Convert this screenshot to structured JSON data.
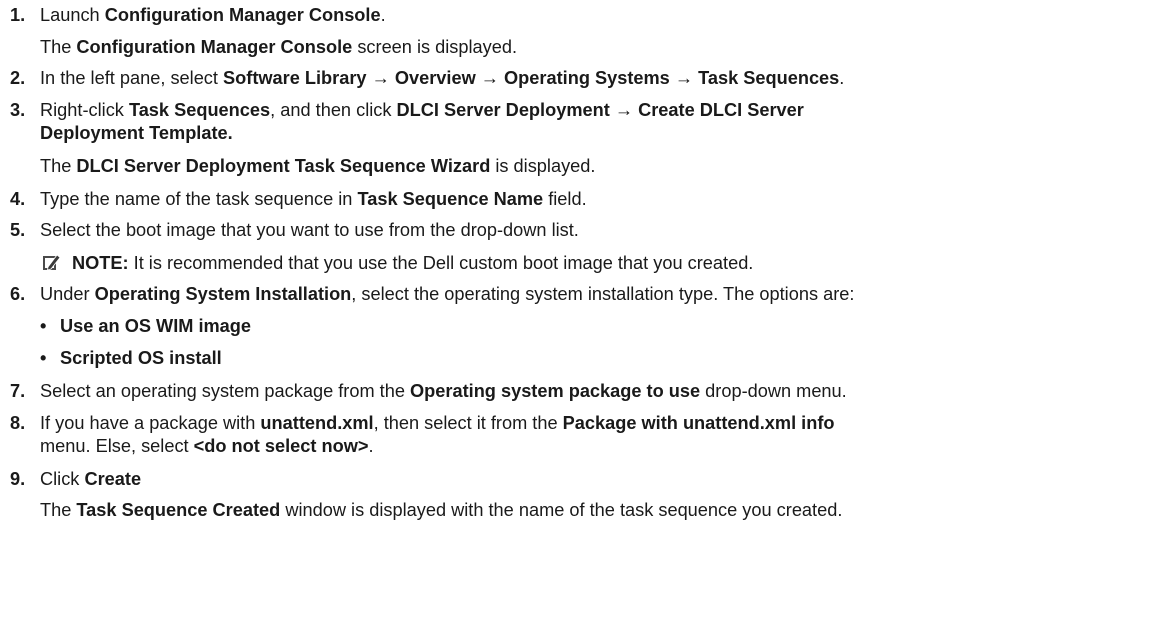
{
  "steps": [
    {
      "number": "1.",
      "parts": [
        [
          "Launch ",
          false
        ],
        [
          "Configuration Manager Console",
          true
        ],
        [
          ".",
          false
        ]
      ]
    },
    {
      "number": "",
      "parts": [
        [
          "The ",
          false
        ],
        [
          "Configuration Manager Console",
          true
        ],
        [
          " screen is displayed.",
          false
        ]
      ]
    },
    {
      "number": "2.",
      "parts": [
        [
          "In the left pane, select ",
          false
        ],
        [
          "Software Library",
          true
        ],
        [
          " → ",
          false
        ],
        [
          "Overview",
          true
        ],
        [
          " → ",
          false
        ],
        [
          "Operating Systems",
          true
        ],
        [
          " → ",
          false
        ],
        [
          "Task Sequences",
          true
        ],
        [
          ".",
          false
        ]
      ]
    },
    {
      "number": "3.",
      "parts": [
        [
          "Right-click ",
          false
        ],
        [
          "Task Sequences",
          true
        ],
        [
          ", and then click ",
          false
        ],
        [
          "DLCI Server Deployment",
          true
        ],
        [
          " → ",
          false
        ],
        [
          "Create DLCI Server",
          true
        ]
      ]
    },
    {
      "number": "",
      "parts": [
        [
          "Deployment Template.",
          true
        ]
      ]
    },
    {
      "number": "",
      "parts": [
        [
          "The ",
          false
        ],
        [
          "DLCI Server Deployment Task Sequence Wizard",
          true
        ],
        [
          " is displayed.",
          false
        ]
      ]
    },
    {
      "number": "4.",
      "parts": [
        [
          "Type the name of the task sequence in ",
          false
        ],
        [
          "Task Sequence Name",
          true
        ],
        [
          " field.",
          false
        ]
      ]
    },
    {
      "number": "5.",
      "parts": [
        [
          "Select the boot image that you want to use from the drop-down list.",
          false
        ]
      ]
    },
    {
      "number": "6.",
      "parts": [
        [
          "Under ",
          false
        ],
        [
          "Operating System Installation",
          true
        ],
        [
          ", select the operating system installation type. The options are:",
          false
        ]
      ]
    },
    {
      "number": "7.",
      "parts": [
        [
          "Select an operating system package from the ",
          false
        ],
        [
          "Operating system package to use",
          true
        ],
        [
          " drop-down menu.",
          false
        ]
      ]
    },
    {
      "number": "8.",
      "parts": [
        [
          "If you have a package with ",
          false
        ],
        [
          "unattend.xml",
          true
        ],
        [
          ", then select it from the ",
          false
        ],
        [
          "Package with unattend.xml info",
          true
        ]
      ]
    },
    {
      "number": "",
      "parts": [
        [
          "menu. Else, select ",
          false
        ],
        [
          "<do not select now>",
          true
        ],
        [
          ".",
          false
        ]
      ]
    },
    {
      "number": "9.",
      "parts": [
        [
          "Click ",
          false
        ],
        [
          "Create",
          true
        ]
      ]
    },
    {
      "number": "",
      "parts": [
        [
          "The ",
          false
        ],
        [
          "Task Sequence Created",
          true
        ],
        [
          " window is displayed with the name of the task sequence you created.",
          false
        ]
      ]
    }
  ],
  "note": {
    "icon": "pencil-note-icon",
    "label": "NOTE:",
    "text": " It is recommended that you use the Dell custom boot image that you created."
  },
  "options": [
    "Use an OS WIM image",
    "Scripted OS install"
  ],
  "bullet_char": "•"
}
